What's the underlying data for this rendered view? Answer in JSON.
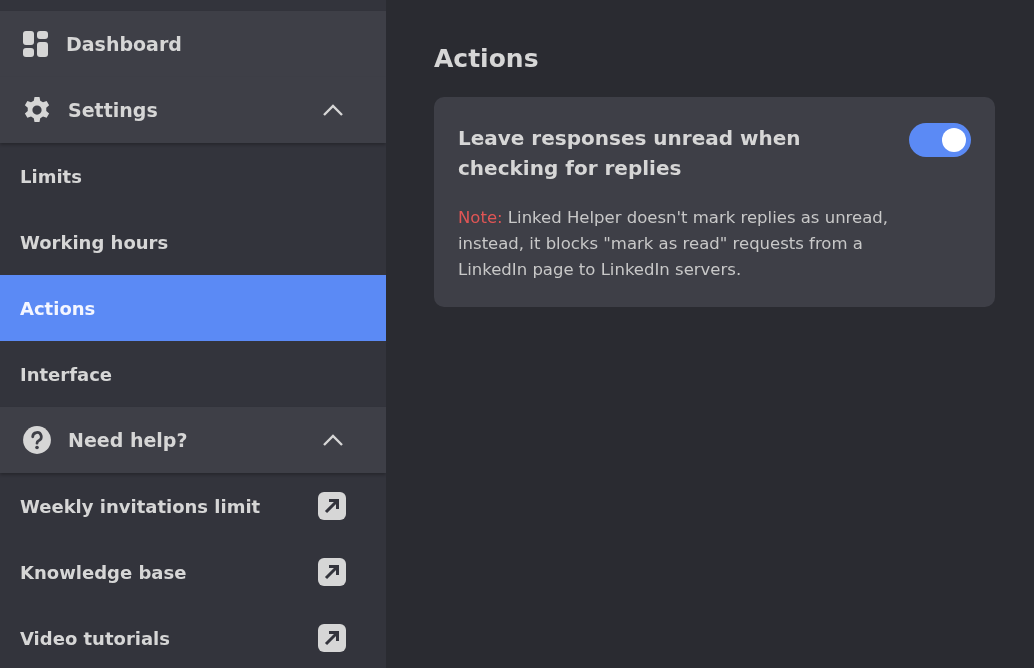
{
  "sidebar": {
    "items": [
      {
        "kind": "page",
        "label": "Dashboard"
      },
      {
        "kind": "group",
        "label": "Settings",
        "expanded": true,
        "children": [
          {
            "kind": "page",
            "label": "Limits",
            "selected": false
          },
          {
            "kind": "page",
            "label": "Working hours",
            "selected": false
          },
          {
            "kind": "page",
            "label": "Actions",
            "selected": true
          },
          {
            "kind": "page",
            "label": "Interface",
            "selected": false
          }
        ]
      },
      {
        "kind": "group",
        "label": "Need help?",
        "expanded": true,
        "children": [
          {
            "kind": "external",
            "label": "Weekly invitations limit",
            "selected": false
          },
          {
            "kind": "external",
            "label": "Knowledge base",
            "selected": false
          },
          {
            "kind": "external",
            "label": "Video tutorials",
            "selected": false
          }
        ]
      }
    ]
  },
  "page": {
    "title": "Actions",
    "settings": [
      {
        "label": "Leave responses unread when checking for replies",
        "on": true,
        "note_label": "Note:",
        "note": "Linked Helper doesn't mark replies as unread, instead, it blocks \"mark as read\" requests from a LinkedIn page to LinkedIn servers."
      }
    ]
  }
}
